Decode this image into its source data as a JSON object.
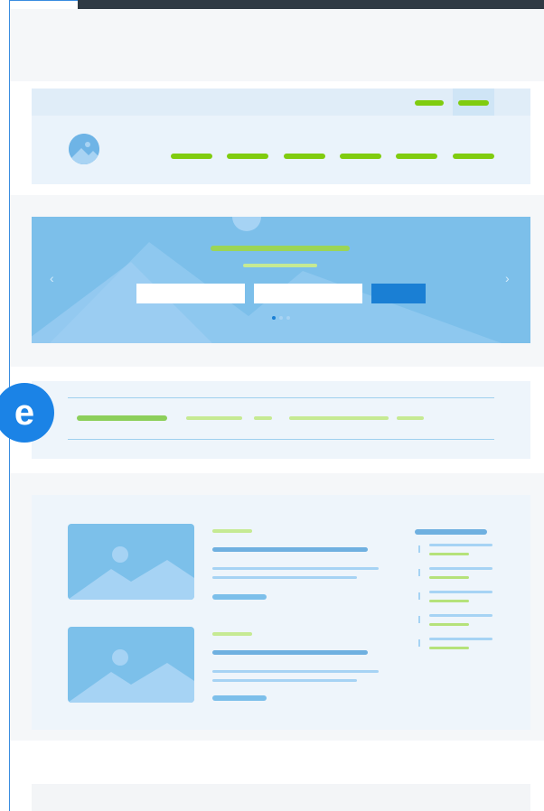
{
  "colors": {
    "nav_green": "#80cc0f",
    "accent_blue": "#1a7fd4",
    "hero_blue": "#7cbfea",
    "panel_bg": "#eaf3fb",
    "band_bg": "#f5f7f9"
  },
  "badge": {
    "letter": "e"
  },
  "header": {
    "logo_icon": "avatar-circle-icon",
    "nav_item_count_text": ""
  },
  "hero": {
    "prev_arrow": "‹",
    "next_arrow": "›",
    "dots": [
      "active",
      "inactive",
      "inactive"
    ]
  }
}
